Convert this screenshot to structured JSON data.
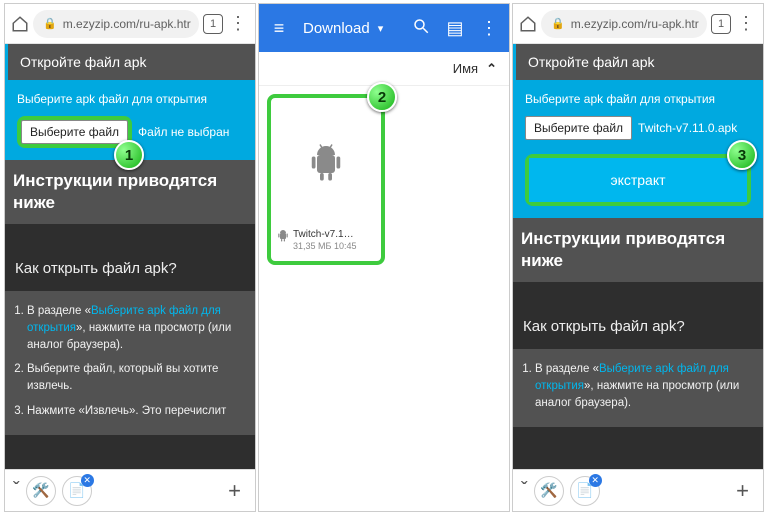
{
  "browser": {
    "url": "m.ezyzip.com/ru-apk.htr",
    "tab_count": "1",
    "home_aria": "home"
  },
  "bottom": {
    "chev": "ˇ",
    "plus": "+"
  },
  "page1": {
    "title": "Откройте файл apk",
    "pick_label": "Выберите apk файл для открытия",
    "file_button": "Выберите файл",
    "file_status": "Файл не выбран",
    "instr_heading": "Инструкции приводятся ниже",
    "faq_heading": "Как открыть файл apk?",
    "steps": {
      "s1a": "В разделе «",
      "s1link": "Выберите apk файл для открытия",
      "s1b": "», нажмите на просмотр (или аналог браузера).",
      "s2": "Выберите файл, который вы хотите извлечь.",
      "s3": "Нажмите «Извлечь». Это перечислит"
    }
  },
  "panel2": {
    "title": "Download",
    "sort_label": "Имя",
    "file": {
      "name": "Twitch-v7.1…",
      "size": "31,35 МБ",
      "time": "10:45"
    }
  },
  "page3": {
    "title": "Откройте файл apk",
    "pick_label": "Выберите apk файл для открытия",
    "file_button": "Выберите файл",
    "file_status": "Twitch-v7.11.0.apk",
    "extract": "экстракт",
    "instr_heading": "Инструкции приводятся ниже",
    "faq_heading": "Как открыть файл apk?",
    "steps": {
      "s1a": "В разделе «",
      "s1link": "Выберите apk файл для открытия",
      "s1b": "», нажмите на просмотр (или аналог браузера)."
    }
  },
  "callouts": {
    "c1": "1",
    "c2": "2",
    "c3": "3"
  }
}
